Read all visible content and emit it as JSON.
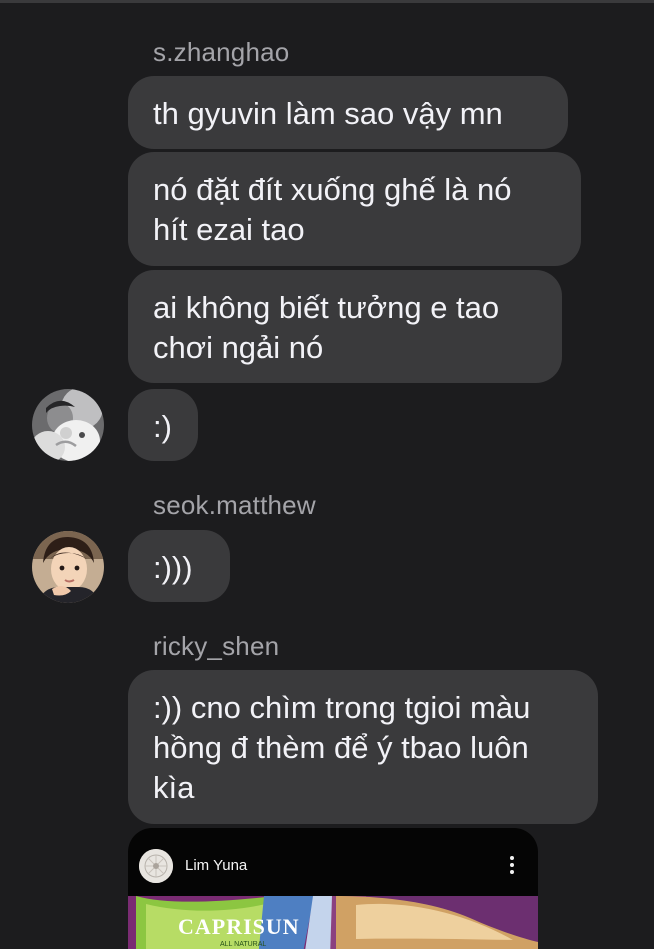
{
  "chat": {
    "groups": [
      {
        "sender": "s.zhanghao",
        "messages": [
          "th gyuvin làm sao vậy mn",
          "nó đặt đít xuống ghế là nó\nhít ezai tao",
          "ai không biết tưởng e tao\nchơi ngải nó",
          ":)"
        ]
      },
      {
        "sender": "seok.matthew",
        "messages": [
          ":)))"
        ]
      },
      {
        "sender": "ricky_shen",
        "messages": [
          ":)) cno chìm trong tgioi màu\nhồng đ thèm để ý tbao luôn\nkìa"
        ]
      }
    ],
    "shared_post": {
      "username": "Lim Yuna",
      "more_icon": "more-vertical-icon",
      "image_brand_text": "CAPRISUN",
      "image_brand_subtext": "ALL NATURAL"
    }
  },
  "colors": {
    "background": "#1c1c1e",
    "bubble": "#3a3a3c",
    "text": "#f2f2f7",
    "sender": "#a4a4a9"
  }
}
